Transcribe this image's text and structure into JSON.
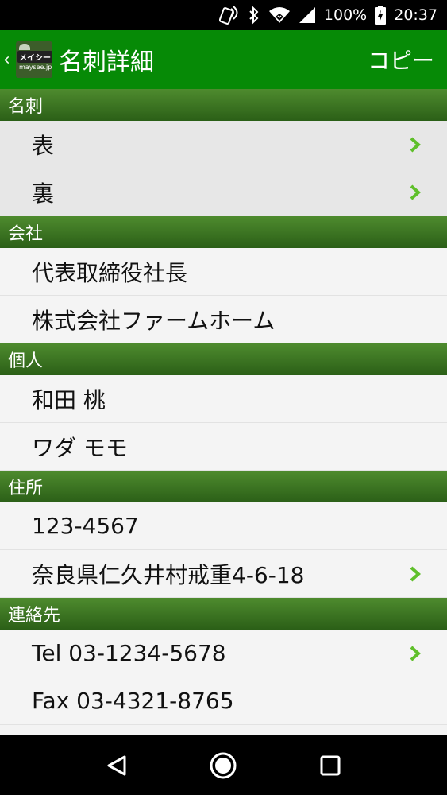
{
  "status_bar": {
    "battery": "100%",
    "time": "20:37",
    "icons": [
      "nfc-icon",
      "bluetooth-icon",
      "wifi-icon",
      "signal-icon",
      "battery-charging-icon"
    ]
  },
  "action_bar": {
    "logo_text": "メイシー",
    "logo_sub": "maysee.jp",
    "title": "名刺詳細",
    "copy_label": "コピー"
  },
  "sections": [
    {
      "header": "名刺",
      "rows": [
        {
          "text": "表",
          "chevron": true
        },
        {
          "text": "裏",
          "chevron": true
        }
      ]
    },
    {
      "header": "会社",
      "rows": [
        {
          "text": "代表取締役社長",
          "chevron": false
        },
        {
          "text": "株式会社ファームホーム",
          "chevron": false
        }
      ]
    },
    {
      "header": "個人",
      "rows": [
        {
          "text": "和田 桃",
          "chevron": false
        },
        {
          "text": "ワダ モモ",
          "chevron": false
        }
      ]
    },
    {
      "header": "住所",
      "rows": [
        {
          "text": "123-4567",
          "chevron": false
        },
        {
          "text": "奈良県仁久井村戒重4-6-18",
          "chevron": true
        }
      ]
    },
    {
      "header": "連絡先",
      "rows": [
        {
          "text": "Tel 03-1234-5678",
          "chevron": true
        },
        {
          "text": "Fax 03-4321-8765",
          "chevron": false
        }
      ]
    }
  ],
  "colors": {
    "action_bar": "#068a06",
    "section_header": "#2b5f17",
    "chevron": "#5fbf2a"
  },
  "nav_bar": {
    "buttons": [
      "back-triangle-icon",
      "home-circle-icon",
      "recents-square-icon"
    ]
  }
}
